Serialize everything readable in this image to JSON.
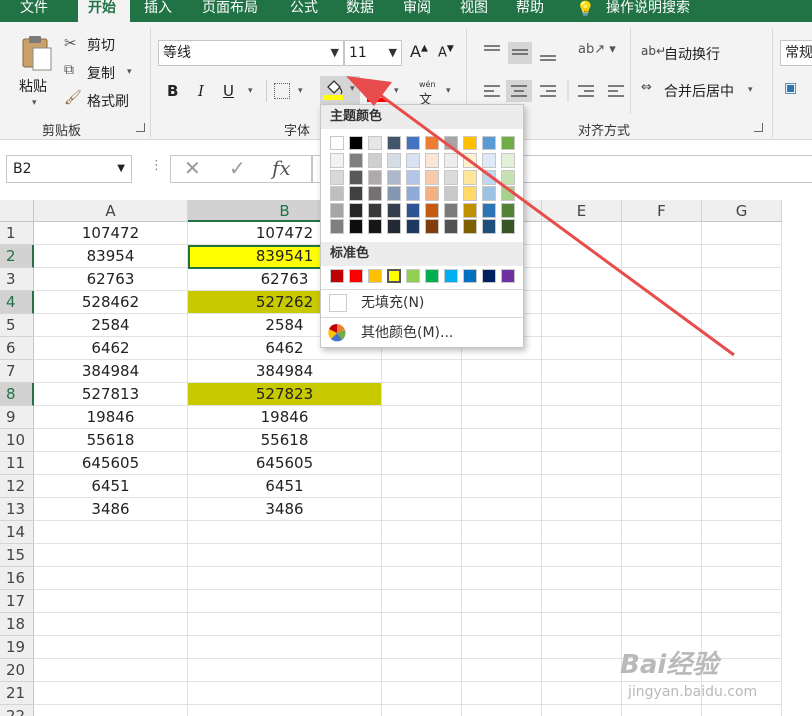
{
  "tabs": [
    "文件",
    "开始",
    "插入",
    "页面布局",
    "公式",
    "数据",
    "审阅",
    "视图",
    "帮助",
    "操作说明搜索"
  ],
  "active_tab": "开始",
  "clipboard": {
    "paste": "粘贴",
    "cut": "剪切",
    "copy": "复制",
    "format_painter": "格式刷",
    "group": "剪贴板"
  },
  "font": {
    "name": "等线",
    "size": "11",
    "grow": "A",
    "shrink": "A",
    "bold": "B",
    "italic": "I",
    "underline": "U",
    "font_color_glyph": "A",
    "phonetic_top": "wén",
    "phonetic_bottom": "文",
    "group": "字体",
    "fill_color": "#ffff00",
    "font_color": "#ff0000"
  },
  "alignment": {
    "wrap_text": "自动换行",
    "merge_center": "合并后居中",
    "group": "对齐方式"
  },
  "number": {
    "format": "常规"
  },
  "formula_bar": {
    "name_box": "B2",
    "cancel": "✕",
    "enter": "✓",
    "fx": "fx"
  },
  "grid": {
    "columns": [
      "A",
      "B",
      "C",
      "D",
      "E",
      "F",
      "G"
    ],
    "selected_column": "B",
    "rows": [
      "1",
      "2",
      "3",
      "4",
      "5",
      "6",
      "7",
      "8",
      "9",
      "10",
      "11",
      "12",
      "13",
      "14",
      "15",
      "16",
      "17",
      "18",
      "19",
      "20",
      "21",
      "22"
    ],
    "selected_rows": [
      "2",
      "4",
      "8"
    ],
    "data": [
      [
        "107472",
        "107472"
      ],
      [
        "83954",
        "839541"
      ],
      [
        "62763",
        "62763"
      ],
      [
        "528462",
        "527262"
      ],
      [
        "2584",
        "2584"
      ],
      [
        "6462",
        "6462"
      ],
      [
        "384984",
        "384984"
      ],
      [
        "527813",
        "527823"
      ],
      [
        "19846",
        "19846"
      ],
      [
        "55618",
        "55618"
      ],
      [
        "645605",
        "645605"
      ],
      [
        "6451",
        "6451"
      ],
      [
        "3486",
        "3486"
      ]
    ],
    "highlights": {
      "B2": "#ffff00",
      "B4": "#c9c900",
      "B8": "#c9c900"
    }
  },
  "fill_dropdown": {
    "theme_colors_label": "主题颜色",
    "standard_colors_label": "标准色",
    "no_fill": "无填充(N)",
    "more_colors": "其他颜色(M)...",
    "theme_colors": [
      [
        "#ffffff",
        "#f2f2f2",
        "#d9d9d9",
        "#bfbfbf",
        "#a6a6a6",
        "#7f7f7f"
      ],
      [
        "#000000",
        "#7f7f7f",
        "#595959",
        "#404040",
        "#262626",
        "#0d0d0d"
      ],
      [
        "#e7e6e6",
        "#d0cece",
        "#aeaaaa",
        "#757171",
        "#3a3838",
        "#171616"
      ],
      [
        "#44546a",
        "#d6dce4",
        "#acb9ca",
        "#8497b0",
        "#333f4f",
        "#222a35"
      ],
      [
        "#4472c4",
        "#d9e2f3",
        "#b4c6e7",
        "#8eaadb",
        "#2f5496",
        "#1f3864"
      ],
      [
        "#ed7d31",
        "#fbe5d5",
        "#f7caac",
        "#f4b083",
        "#c55a11",
        "#833c0b"
      ],
      [
        "#a5a5a5",
        "#ededed",
        "#dbdbdb",
        "#c9c9c9",
        "#7b7b7b",
        "#525252"
      ],
      [
        "#ffc000",
        "#fff2cc",
        "#ffe599",
        "#ffd966",
        "#bf9000",
        "#7f6000"
      ],
      [
        "#5b9bd5",
        "#deebf6",
        "#bdd7ee",
        "#9cc3e5",
        "#2e75b5",
        "#1e4e79"
      ],
      [
        "#70ad47",
        "#e2efd9",
        "#c5e0b3",
        "#a8d08d",
        "#538135",
        "#375623"
      ]
    ],
    "standard_colors": [
      "#c00000",
      "#ff0000",
      "#ffc000",
      "#ffff00",
      "#92d050",
      "#00b050",
      "#00b0f0",
      "#0070c0",
      "#002060",
      "#7030a0"
    ],
    "selected_standard": "#ffff00"
  },
  "annotation_color": "#e84c4c",
  "watermark": {
    "main": "Bai经验",
    "sub": "jingyan.baidu.com"
  }
}
